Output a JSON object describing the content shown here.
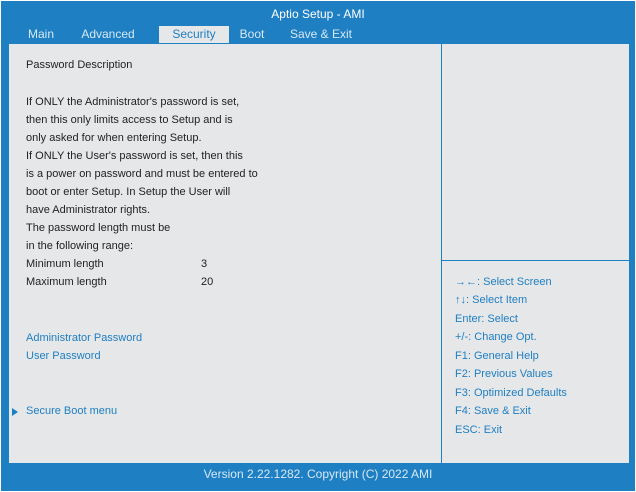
{
  "title": "Aptio Setup - AMI",
  "tabs": [
    {
      "label": "Main"
    },
    {
      "label": "Advanced"
    },
    {
      "label": "Security"
    },
    {
      "label": "Boot"
    },
    {
      "label": "Save & Exit"
    }
  ],
  "active_tab": "Security",
  "description": {
    "heading": "Password Description",
    "lines": [
      "If ONLY the Administrator's password is set,",
      "then this only limits access to Setup and is",
      "only asked for when entering Setup.",
      "If ONLY the User's password is set, then this",
      "is a power on password and must be entered to",
      "boot or enter Setup. In Setup the User will",
      "have Administrator rights.",
      "The password length must be",
      "in the following range:"
    ],
    "min_label": "Minimum length",
    "min_value": "3",
    "max_label": "Maximum length",
    "max_value": "20"
  },
  "items": {
    "admin_password": "Administrator Password",
    "user_password": "User Password",
    "secure_boot": "Secure Boot menu"
  },
  "help": [
    "→←: Select Screen",
    "↑↓: Select Item",
    "Enter: Select",
    "+/-: Change Opt.",
    "F1: General Help",
    "F2: Previous Values",
    "F3: Optimized Defaults",
    "F4: Save & Exit",
    "ESC: Exit"
  ],
  "footer": "Version 2.22.1282. Copyright  (C)  2022 AMI",
  "colors": {
    "accent": "#1f7fc3",
    "panel": "#e6e7e8",
    "text": "#222222"
  }
}
